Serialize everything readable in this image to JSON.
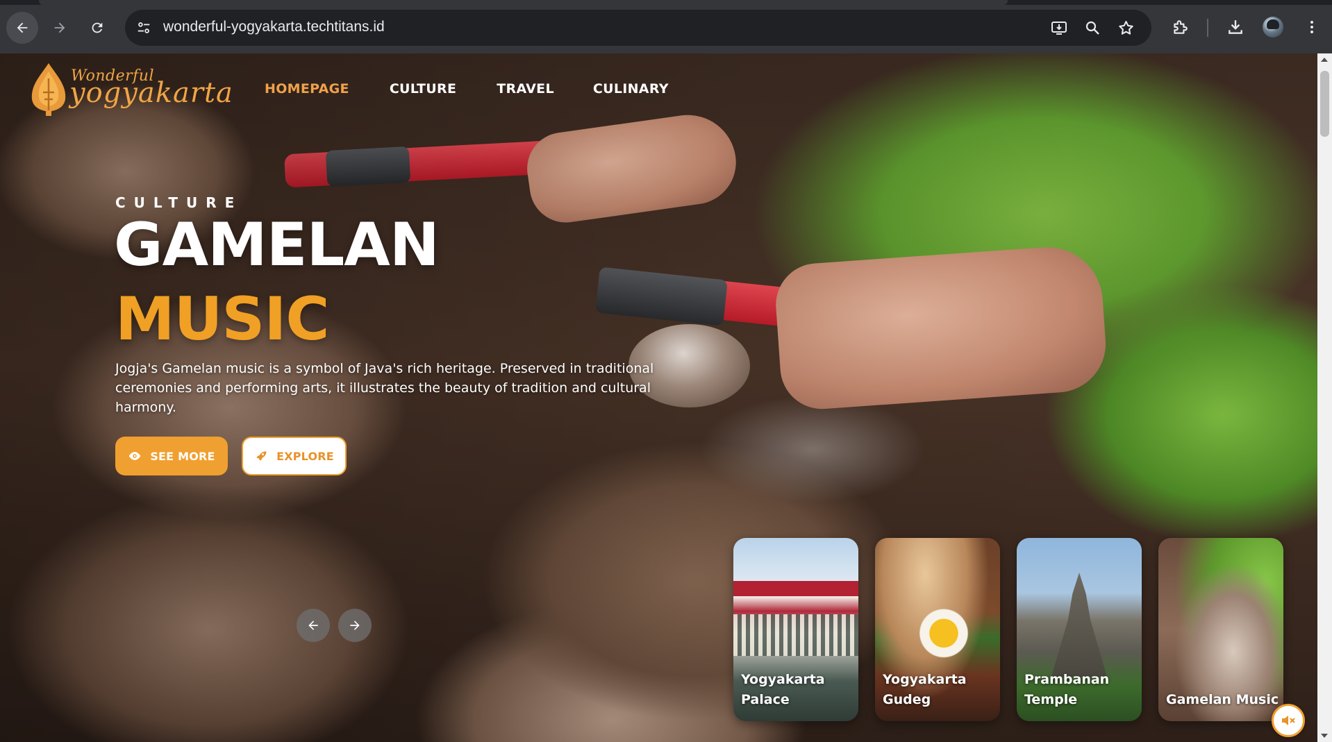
{
  "browser": {
    "url": "wonderful-yogyakarta.techtitans.id",
    "icons": [
      "back-arrow-icon",
      "forward-arrow-icon",
      "reload-icon",
      "site-info-icon",
      "install-app-icon",
      "zoom-icon",
      "bookmark-star-icon",
      "extensions-icon",
      "download-icon",
      "profile-avatar",
      "kebab-menu-icon"
    ]
  },
  "site": {
    "logo": {
      "word1": "Wonderful",
      "word2": "yogyakarta"
    },
    "nav": [
      {
        "label": "HOMEPAGE",
        "active": true
      },
      {
        "label": "CULTURE",
        "active": false
      },
      {
        "label": "TRAVEL",
        "active": false
      },
      {
        "label": "CULINARY",
        "active": false
      }
    ]
  },
  "hero": {
    "eyebrow": "CULTURE",
    "title_line1": "GAMELAN",
    "title_line2": "MUSIC",
    "description": "Jogja's Gamelan music is a symbol of Java's rich heritage. Preserved in traditional ceremonies and performing arts, it illustrates the beauty of tradition and cultural harmony.",
    "see_more_label": "SEE MORE",
    "explore_label": "EXPLORE"
  },
  "cards": [
    {
      "label": "Yogyakarta Palace"
    },
    {
      "label": "Yogyakarta Gudeg"
    },
    {
      "label": "Prambanan Temple"
    },
    {
      "label": "Gamelan Music"
    }
  ],
  "colors": {
    "accent": "#f0a030",
    "nav_active": "#f0a24a",
    "chrome_bg": "#35363a",
    "omnibox_bg": "#202124"
  }
}
